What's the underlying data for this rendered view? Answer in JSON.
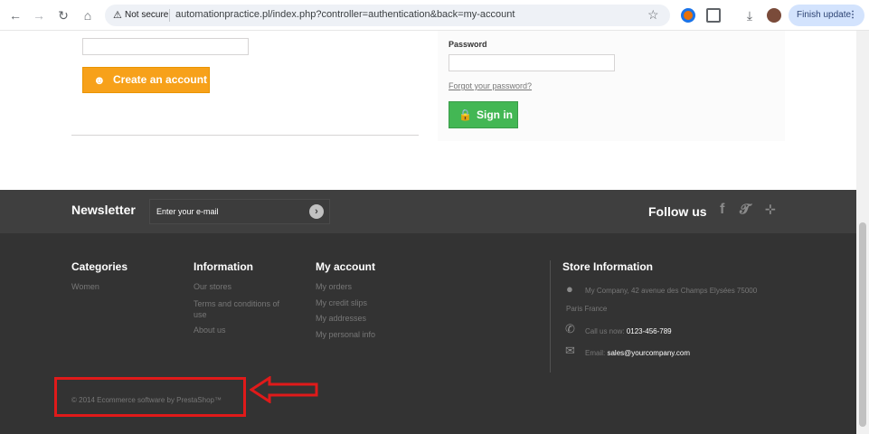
{
  "browser": {
    "security_label": "Not secure",
    "url": "automationpractice.pl/index.php?controller=authentication&back=my-account",
    "update_label": "Finish update"
  },
  "login": {
    "create_account_label": "Create an account",
    "password_label": "Password",
    "forgot_password_label": "Forgot your password?",
    "sign_in_label": "Sign in"
  },
  "newsletter": {
    "title": "Newsletter",
    "placeholder": "Enter your e-mail",
    "follow_title": "Follow us"
  },
  "footer": {
    "categories": {
      "title": "Categories",
      "items": [
        "Women"
      ]
    },
    "information": {
      "title": "Information",
      "items": [
        "Our stores",
        "Terms and conditions of use",
        "About us"
      ]
    },
    "my_account": {
      "title": "My account",
      "items": [
        "My orders",
        "My credit slips",
        "My addresses",
        "My personal info"
      ]
    },
    "store": {
      "title": "Store Information",
      "address_line1": "My Company, 42 avenue des Champs Elysées 75000",
      "address_line2": "Paris France",
      "phone_prefix": "Call us now:",
      "phone": "0123-456-789",
      "email_prefix": "Email:",
      "email": "sales@yourcompany.com"
    },
    "copyright": "© 2014 Ecommerce software by PrestaShop™"
  },
  "annotation": {
    "color": "#e01a1a"
  }
}
